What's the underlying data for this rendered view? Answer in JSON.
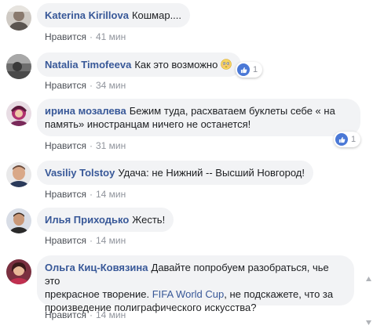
{
  "comments": [
    {
      "author": "Katerina Kirillova",
      "text": "Кошмар....",
      "like_label": "Нравится",
      "separator": "·",
      "time": "41 мин"
    },
    {
      "author": "Natalia Timofeeva",
      "text": "Как это возможно",
      "emoji": "flushed-face-emoji",
      "like_label": "Нравится",
      "separator": "·",
      "time": "34 мин",
      "reactions": {
        "icon": "like-icon",
        "count": "1"
      }
    },
    {
      "author": "ирина мозалева",
      "text_line1": "Бежим туда, расхватаем буклеты себе « на",
      "text_line2": "память» иностранцам ничего не останется!",
      "like_label": "Нравится",
      "separator": "·",
      "time": "31 мин",
      "reactions": {
        "icon": "like-icon",
        "count": "1"
      }
    },
    {
      "author": "Vasiliy Tolstoy",
      "text": "Удача: не Нижний -- Высший Новгород!",
      "like_label": "Нравится",
      "separator": "·",
      "time": "14 мин"
    },
    {
      "author": "Илья Приходько",
      "text": "Жесть!",
      "like_label": "Нравится",
      "separator": "·",
      "time": "14 мин"
    },
    {
      "author": "Ольга Киц-Ковязина",
      "text_line1": "Давайте попробуем разобраться, чье это",
      "text_line2_pre": "прекрасное творение.",
      "mention": "FIFA World Cup",
      "text_line2_post": ", не подскажете, что за",
      "text_line3": "произведение полиграфического искусства?",
      "like_label": "Нравится",
      "separator": "·",
      "time": "14 мин"
    }
  ],
  "colors": {
    "author": "#385898",
    "bubble": "#f2f3f5",
    "meta": "#90949c",
    "like_badge": "#4a78d6"
  }
}
